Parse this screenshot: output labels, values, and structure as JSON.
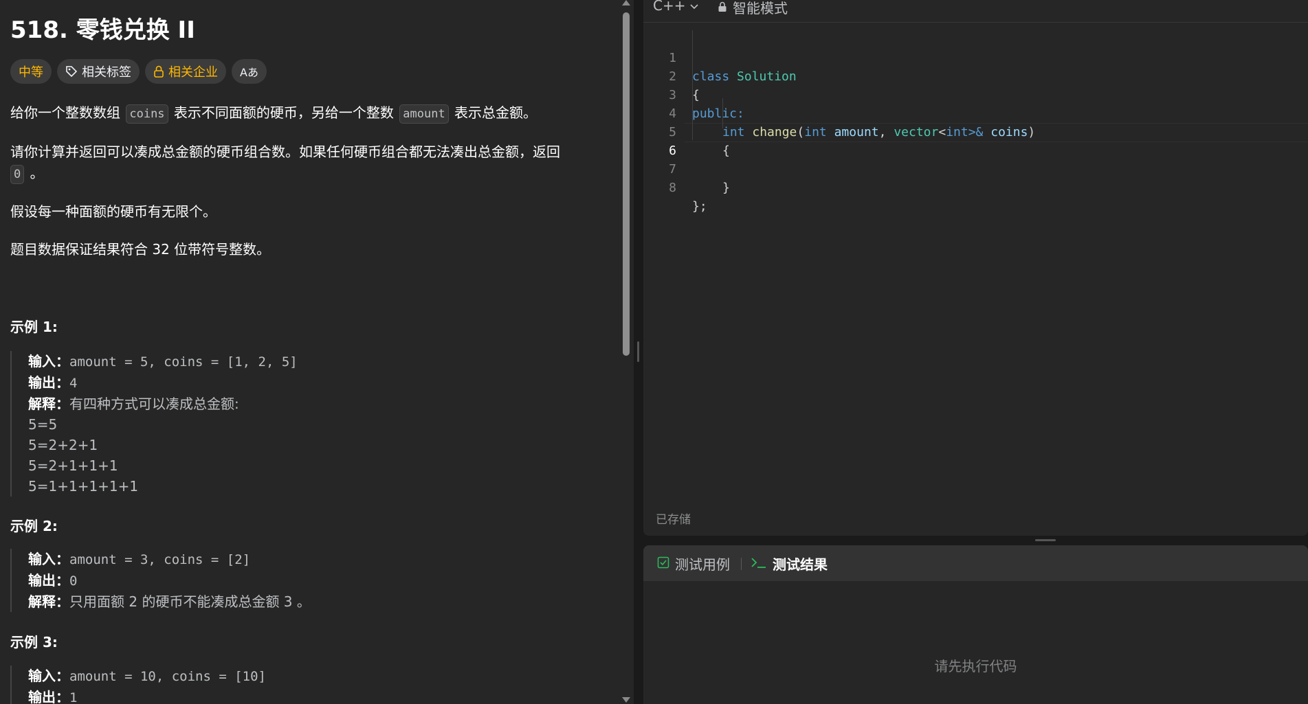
{
  "problem": {
    "title": "518. 零钱兑换 II",
    "tags": {
      "difficulty": "中等",
      "related_tags": "相关标签",
      "related_companies": "相关企业",
      "translate_icon": "Aあ"
    },
    "desc": {
      "p1_a": "给你一个整数数组",
      "p1_code1": "coins",
      "p1_b": "表示不同面额的硬币，另给一个整数",
      "p1_code2": "amount",
      "p1_c": "表示总金额。",
      "p2_a": "请你计算并返回可以凑成总金额的硬币组合数。如果任何硬币组合都无法凑出总金额，返回",
      "p2_code": "0",
      "p2_b": "。",
      "p3": "假设每一种面额的硬币有无限个。",
      "p4": "题目数据保证结果符合 32 位带符号整数。"
    },
    "examples": [
      {
        "head": "示例 1:",
        "input_label": "输入：",
        "input": "amount = 5, coins = [1, 2, 5]",
        "output_label": "输出：",
        "output": "4",
        "explain_label": "解释：",
        "explain": "有四种方式可以凑成总金额:",
        "extra": [
          "5=5",
          "5=2+2+1",
          "5=2+1+1+1",
          "5=1+1+1+1+1"
        ]
      },
      {
        "head": "示例 2:",
        "input_label": "输入：",
        "input": "amount = 3, coins = [2]",
        "output_label": "输出：",
        "output": "0",
        "explain_label": "解释：",
        "explain": "只用面额 2 的硬币不能凑成总金额 3 。"
      },
      {
        "head": "示例 3:",
        "input_label": "输入：",
        "input": "amount = 10, coins = [10]",
        "output_label": "输出：",
        "output": "1"
      }
    ]
  },
  "editor": {
    "language": "C++",
    "mode": "智能模式",
    "line_numbers": [
      "1",
      "2",
      "3",
      "4",
      "5",
      "6",
      "7",
      "8"
    ],
    "saved_status": "已存储",
    "code": {
      "l1_kw": "class",
      "l1_ty": "Solution",
      "l2": "{",
      "l3": "public:",
      "l4_ret": "int",
      "l4_fn": "change",
      "l4_open": "(",
      "l4_t1": "int",
      "l4_p1": "amount",
      "l4_comma": ", ",
      "l4_t2": "vector",
      "l4_lt": "<",
      "l4_t3": "int",
      "l4_gt": ">&",
      "l4_p2": "coins",
      "l4_close": ")",
      "l5": "{",
      "l7": "}",
      "l8": "};"
    }
  },
  "test_panel": {
    "tab_cases": "测试用例",
    "tab_result": "测试结果",
    "empty_hint": "请先执行代码"
  },
  "colors": {
    "difficulty_medium": "#ffb800",
    "keyword": "#569cd6",
    "type": "#4ec9b0",
    "function": "#dcdcaa",
    "param": "#9cdcfe",
    "terminal_green": "#2cbb5d"
  }
}
